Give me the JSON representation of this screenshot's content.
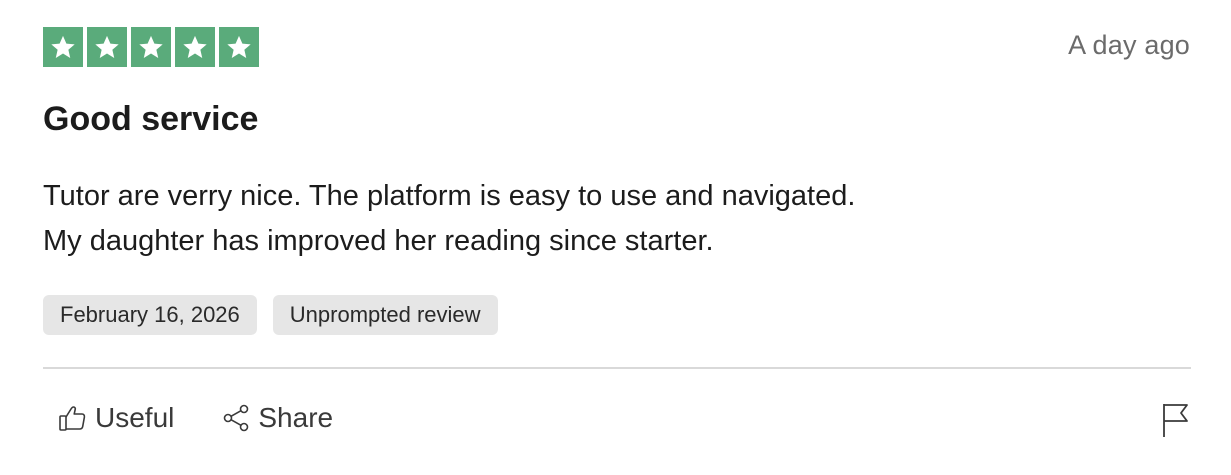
{
  "review": {
    "rating": 5,
    "rating_max": 5,
    "time_ago": "A day ago",
    "title": "Good service",
    "body_line1": "Tutor are verry nice. The platform is easy to use and navigated.",
    "body_line2": "My daughter has improved her reading since starter.",
    "tags": [
      "February 16, 2026",
      "Unprompted review"
    ]
  },
  "actions": {
    "useful_label": "Useful",
    "share_label": "Share"
  },
  "colors": {
    "star_fill": "#5aab7b",
    "tag_bg": "#e6e6e6",
    "divider": "#d9d9d9"
  },
  "icons": {
    "star": "star-icon",
    "useful": "thumbs-up-icon",
    "share": "share-icon",
    "report": "flag-icon"
  }
}
